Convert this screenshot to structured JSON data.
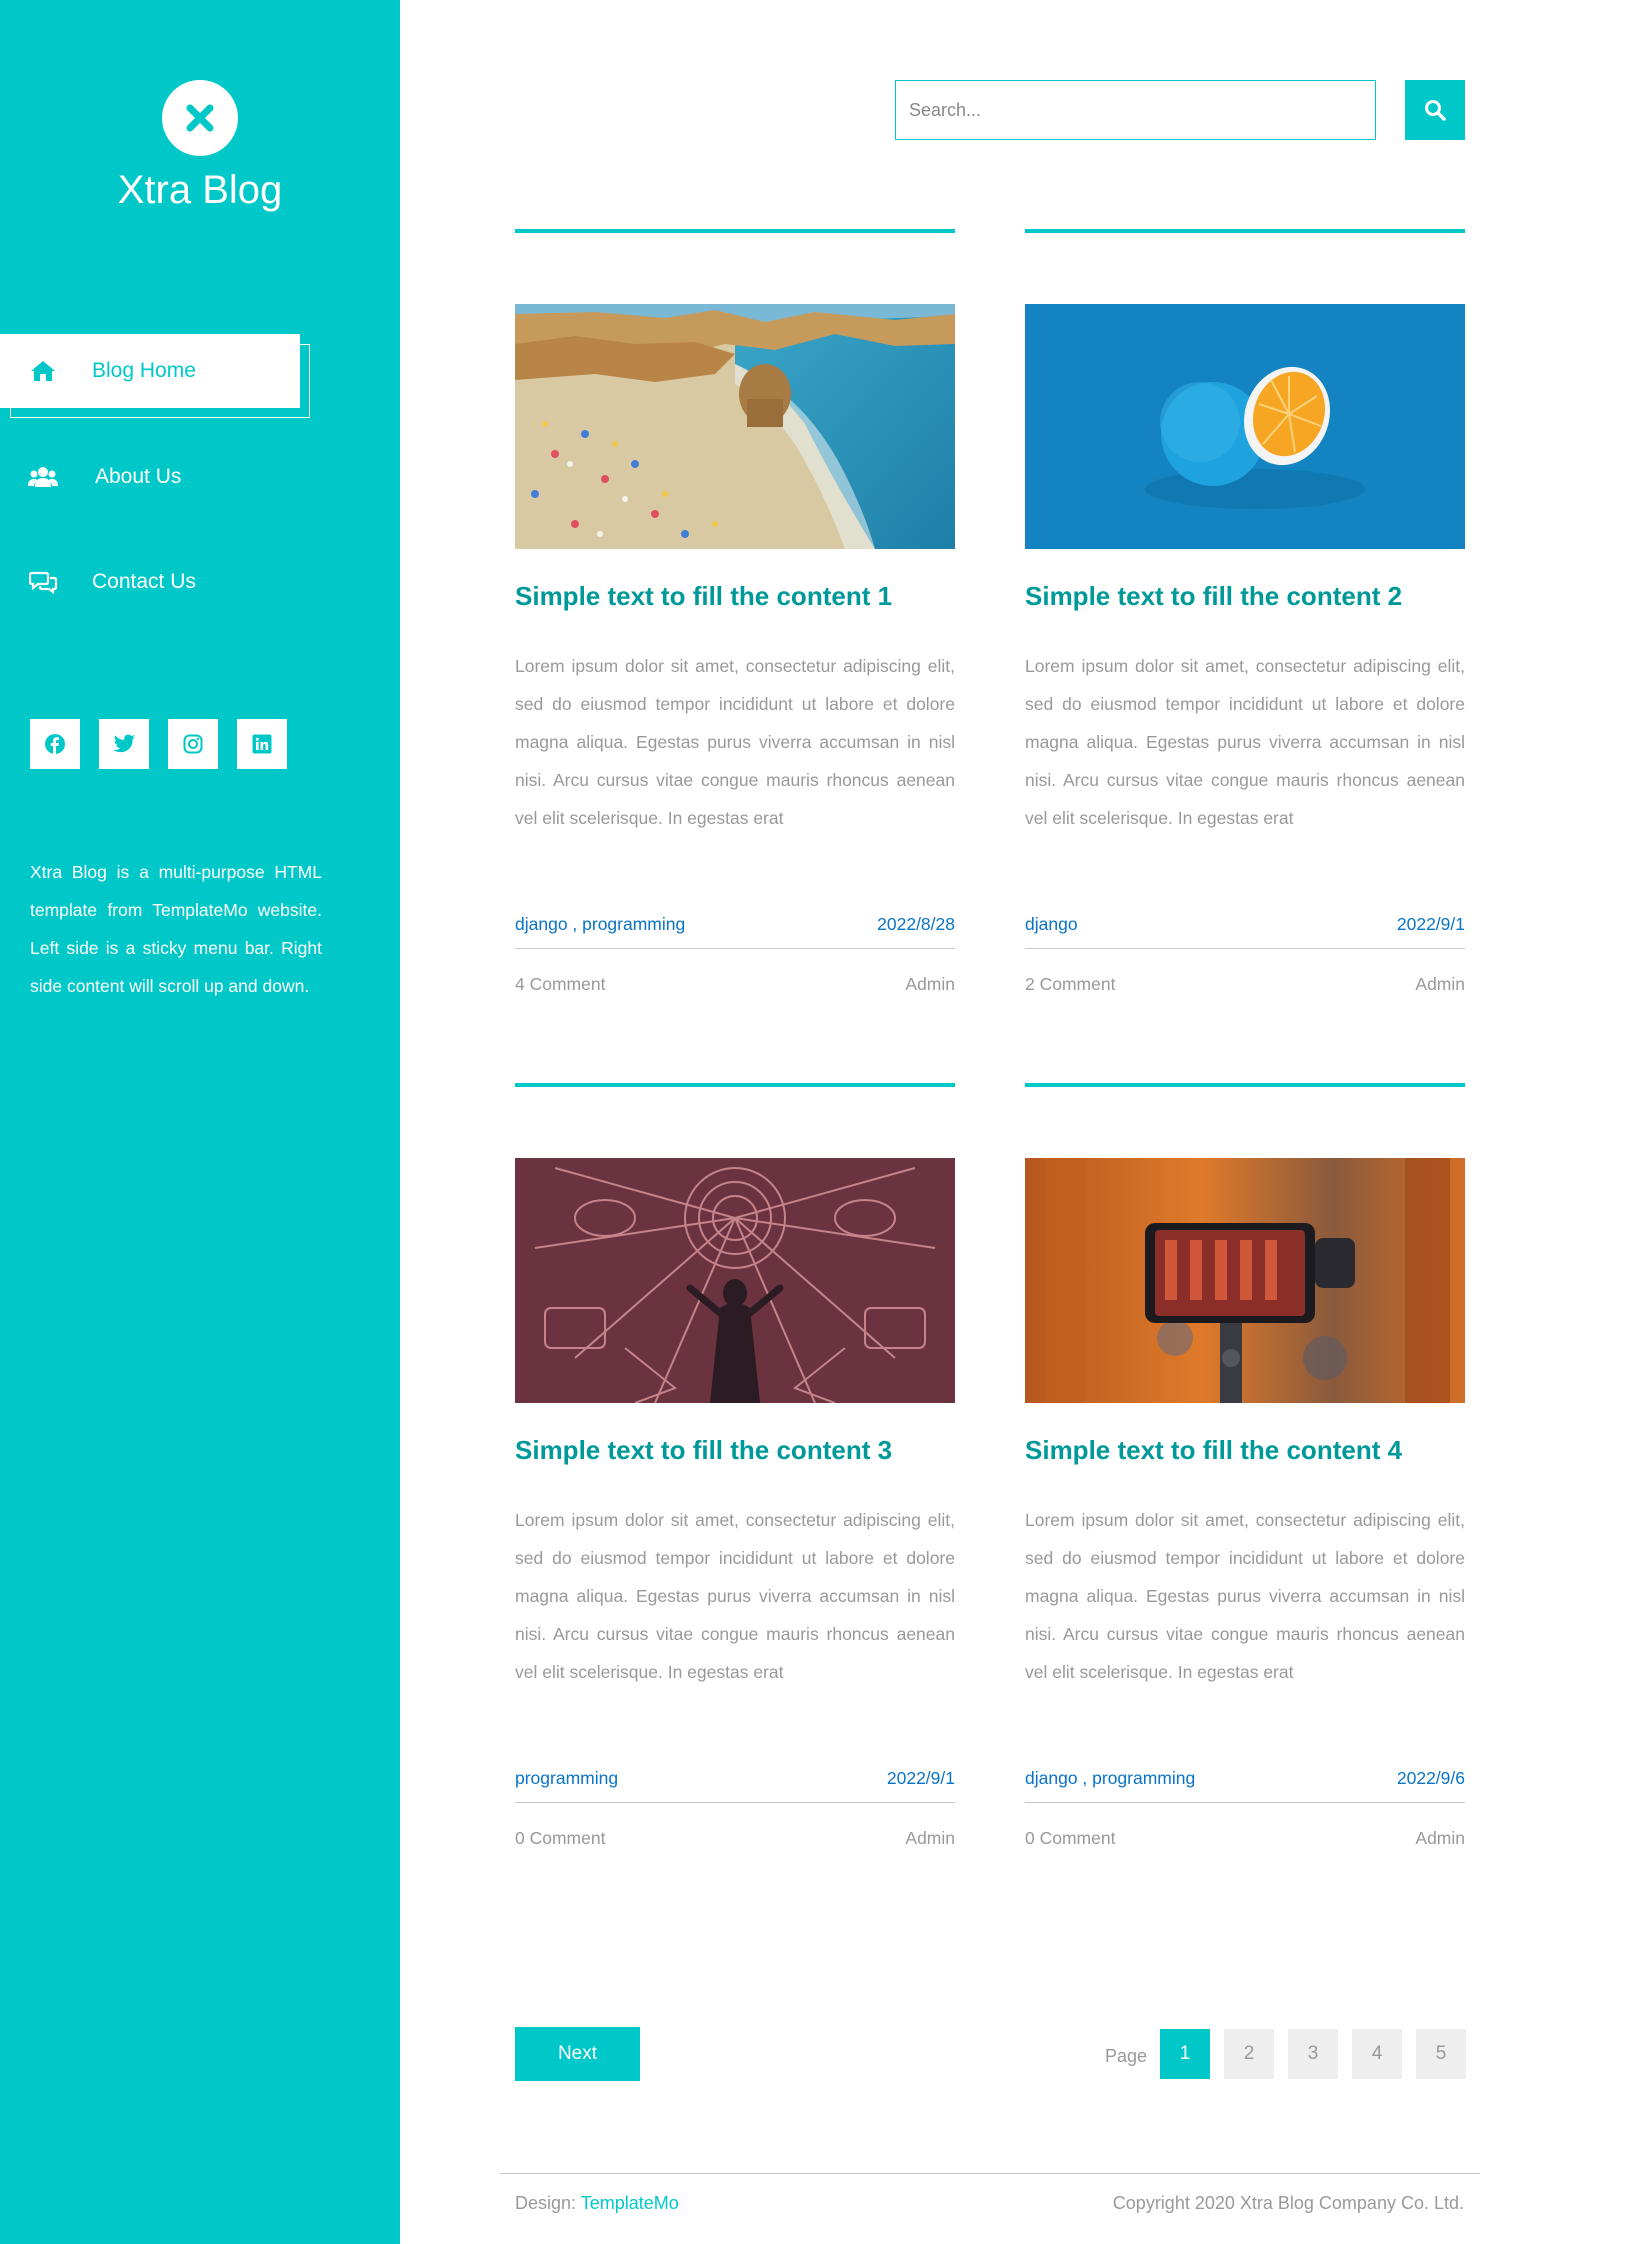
{
  "sidebar": {
    "title": "Xtra Blog",
    "logo_icon": "close-x-icon",
    "nav": [
      {
        "label": "Blog Home",
        "icon": "home-icon",
        "active": true
      },
      {
        "label": "About Us",
        "icon": "users-icon",
        "active": false
      },
      {
        "label": "Contact Us",
        "icon": "chat-icon",
        "active": false
      }
    ],
    "social": [
      "facebook-icon",
      "twitter-icon",
      "instagram-icon",
      "linkedin-icon"
    ],
    "about_text": "Xtra Blog is a multi-purpose HTML template from TemplateMo website. Left side is a sticky menu bar. Right side content will scroll up and down."
  },
  "search": {
    "placeholder": "Search..."
  },
  "posts": [
    {
      "title": "Simple text to fill the content 1",
      "excerpt": "Lorem ipsum dolor sit amet, consectetur adipiscing elit, sed do eiusmod tempor incididunt ut labore et dolore magna aliqua. Egestas purus viverra accumsan in nisl nisi. Arcu cursus vitae congue mauris rhoncus aenean vel elit scelerisque. In egestas erat",
      "tags": "django , programming",
      "date": "2022/8/28",
      "comments": "4 Comment",
      "author": "Admin",
      "image": "beach-photo"
    },
    {
      "title": "Simple text to fill the content 2",
      "excerpt": "Lorem ipsum dolor sit amet, consectetur adipiscing elit, sed do eiusmod tempor incididunt ut labore et dolore magna aliqua. Egestas purus viverra accumsan in nisl nisi. Arcu cursus vitae congue mauris rhoncus aenean vel elit scelerisque. In egestas erat",
      "tags": "django",
      "date": "2022/9/1",
      "comments": "2 Comment",
      "author": "Admin",
      "image": "orange-photo"
    },
    {
      "title": "Simple text to fill the content 3",
      "excerpt": "Lorem ipsum dolor sit amet, consectetur adipiscing elit, sed do eiusmod tempor incididunt ut labore et dolore magna aliqua. Egestas purus viverra accumsan in nisl nisi. Arcu cursus vitae congue mauris rhoncus aenean vel elit scelerisque. In egestas erat",
      "tags": "programming",
      "date": "2022/9/1",
      "comments": "0 Comment",
      "author": "Admin",
      "image": "neon-instruments-photo"
    },
    {
      "title": "Simple text to fill the content 4",
      "excerpt": "Lorem ipsum dolor sit amet, consectetur adipiscing elit, sed do eiusmod tempor incididunt ut labore et dolore magna aliqua. Egestas purus viverra accumsan in nisl nisi. Arcu cursus vitae congue mauris rhoncus aenean vel elit scelerisque. In egestas erat",
      "tags": "django , programming",
      "date": "2022/9/6",
      "comments": "0 Comment",
      "author": "Admin",
      "image": "phone-gimbal-photo"
    }
  ],
  "pagination": {
    "next_label": "Next",
    "page_label": "Page",
    "pages": [
      "1",
      "2",
      "3",
      "4",
      "5"
    ],
    "current": "1"
  },
  "footer": {
    "design_prefix": "Design:",
    "design_link": "TemplateMo",
    "copyright": "Copyright 2020 Xtra Blog Company Co. Ltd."
  },
  "colors": {
    "accent": "#00c8c8",
    "title_teal": "#009999",
    "link_blue": "#0a74c7",
    "muted_text": "#999999"
  }
}
